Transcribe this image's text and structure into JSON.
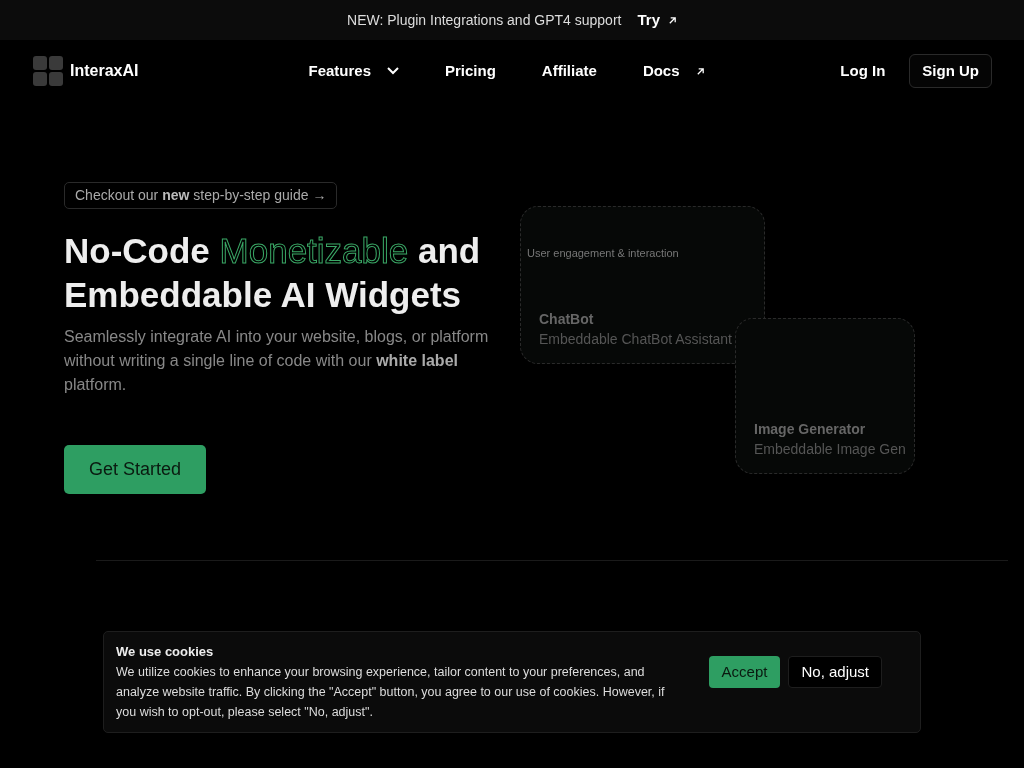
{
  "announcement": {
    "text": "NEW: Plugin Integrations and GPT4 support",
    "link": "Try"
  },
  "navbar": {
    "brand": "InteraxAI",
    "links": [
      {
        "label": "Features",
        "kind": "dropdown"
      },
      {
        "label": "Pricing",
        "kind": "plain"
      },
      {
        "label": "Affiliate",
        "kind": "plain"
      },
      {
        "label": "Docs",
        "kind": "external"
      }
    ],
    "login": "Log In",
    "signup": "Sign Up"
  },
  "hero": {
    "pill": "Checkout our **new** step-by-step guide",
    "pill_arrow": "→",
    "title_start": "No-Code",
    "title_highlight": "Monetizable",
    "title_end": "and Embeddable AI Widgets",
    "subtitle": "Seamlessly integrate AI into your website, blogs, or platform without writing a single line of code with our **white label** platform.",
    "cta": "Get Started"
  },
  "widgets": [
    {
      "caption": "User engagement & interaction",
      "title": "ChatBot",
      "description": "Embeddable ChatBot Assistant"
    },
    {
      "title": "Image Generator",
      "description": "Embeddable Image Gen"
    }
  ],
  "cookie_banner": {
    "title": "We use cookies",
    "text": "We utilize cookies to enhance your browsing experience, tailor content to your preferences, and analyze website traffic. By clicking the \"Accept\" button, you agree to our use of cookies. However, if you wish to opt-out, please select \"No, adjust\".",
    "accept": "Accept",
    "decline": "No, adjust"
  }
}
